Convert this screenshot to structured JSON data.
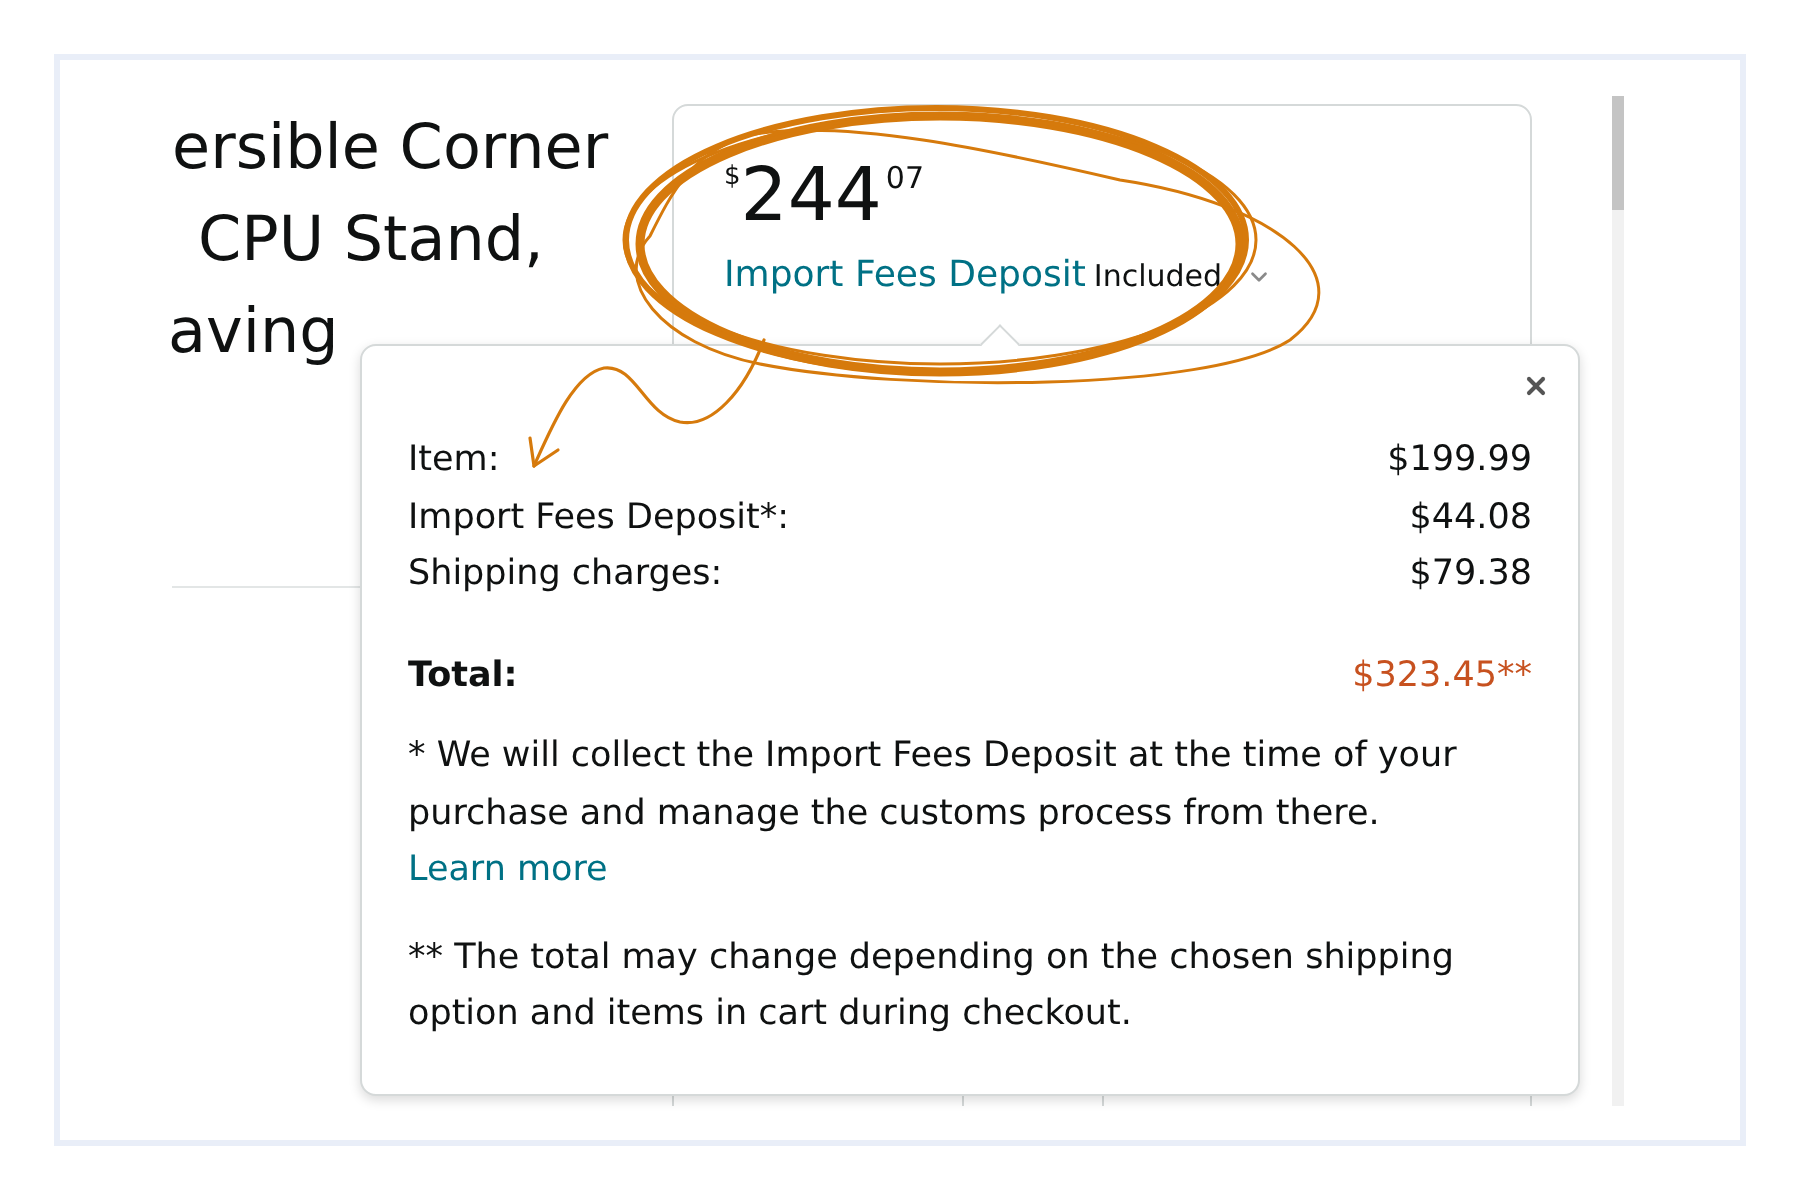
{
  "product_title": {
    "lines": [
      "ersible Corner",
      "CPU Stand,",
      "aving"
    ]
  },
  "price": {
    "currency": "$",
    "whole": "244",
    "fraction": "07",
    "fees_link": "Import Fees Deposit",
    "fees_status": "Included"
  },
  "popover": {
    "rows": [
      {
        "label": "Item:",
        "amount": "$199.99"
      },
      {
        "label": "Import Fees Deposit*:",
        "amount": "$44.08"
      },
      {
        "label": "Shipping charges:",
        "amount": "$79.38"
      }
    ],
    "total": {
      "label": "Total:",
      "amount": "$323.45**"
    },
    "notes": [
      {
        "text": "* We will collect the Import Fees Deposit at the time of your purchase and manage the customs process from there.",
        "link": "Learn more"
      },
      {
        "text": "** The total may change depending on the chosen shipping option and items in cart during checkout."
      }
    ]
  }
}
